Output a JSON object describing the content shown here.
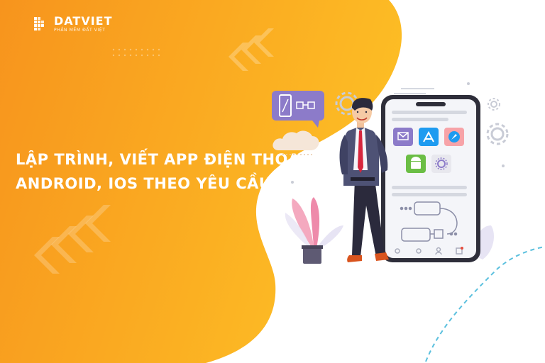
{
  "brand": {
    "name": "DATVIET",
    "tagline": "PHẦN MỀM ĐẤT VIỆT"
  },
  "headline": {
    "line1": "LẬP TRÌNH, VIẾT APP ĐIỆN THOẠI,",
    "line2": "ANDROID, IOS THEO YÊU CẦU"
  },
  "colors": {
    "orange_dark": "#F7941D",
    "orange_light": "#FDB913",
    "purple": "#8C7BC9",
    "phone_frame": "#2E2E3A",
    "blue_dashed": "#5BC0DE"
  },
  "icons": [
    "logo-mark-icon",
    "mail-icon",
    "app-store-icon",
    "safari-icon",
    "android-icon",
    "settings-icon",
    "gear-icon",
    "cloud-icon",
    "plant-icon"
  ]
}
